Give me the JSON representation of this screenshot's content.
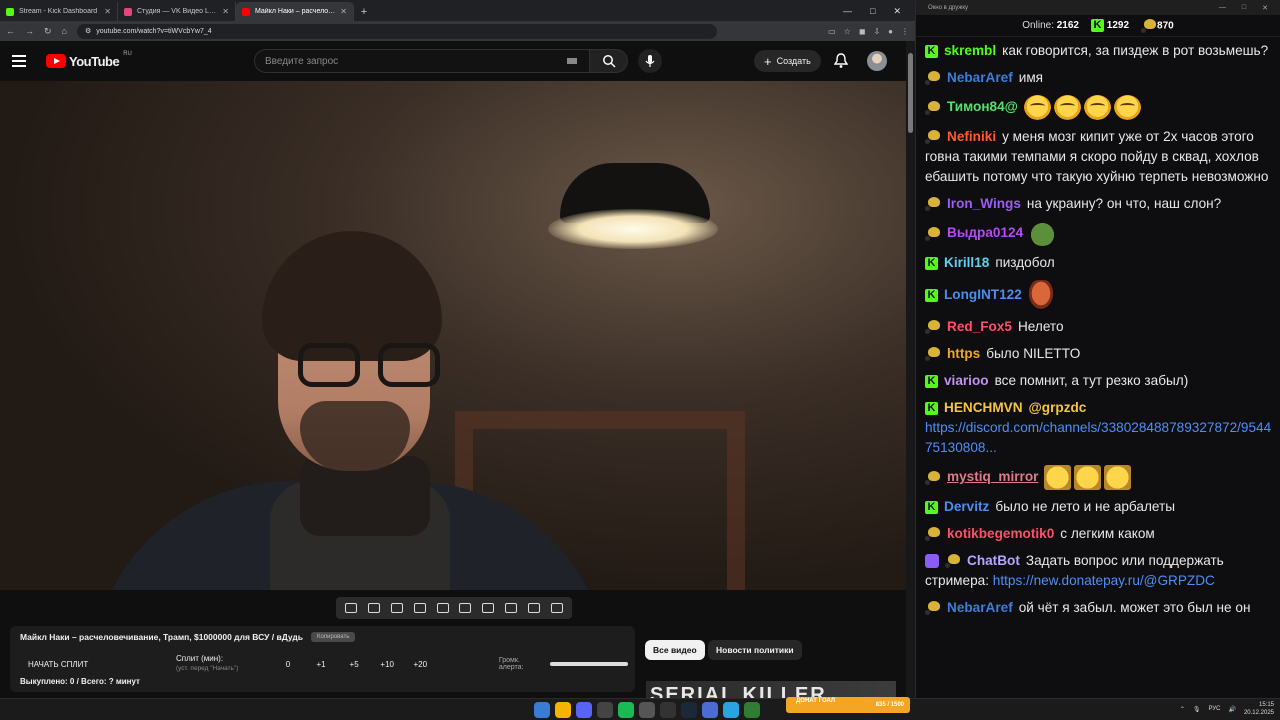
{
  "browser": {
    "tabs": [
      {
        "title": "Stream - Kick Dashboard",
        "color": "#53fc18",
        "active": false
      },
      {
        "title": "Студия — VK Видео Live",
        "color": "#e6457a",
        "active": false
      },
      {
        "title": "Майкл Наки – расчеловечива",
        "color": "#ff0000",
        "active": true
      }
    ],
    "url": "youtube.com/watch?v=tiWVcbYw7_4"
  },
  "youtube": {
    "logo": "YouTube",
    "region": "RU",
    "search_placeholder": "Введите запрос",
    "create_label": "Создать",
    "chips": {
      "all_videos": "Все видео",
      "politics": "Новости политики"
    },
    "thumb_title": "SERIAL KILLER"
  },
  "overlay_panel": {
    "title": "Майкл Наки – расчеловечивание, Трамп, $1000000 для ВСУ / вДудь",
    "copy_label": "Копировать",
    "start_split": "НАЧАТЬ СПЛИТ",
    "split_label": "Сплит (мин):",
    "split_hint": "(уст. перед \"Начать\")",
    "split_value": "0",
    "increments": [
      "+1",
      "+5",
      "+10",
      "+20"
    ],
    "volume_label": "Громк. алерта:",
    "footer": "Выкуплено: 0 / Всего: ? минут"
  },
  "chat": {
    "window_title": "Окно в дружку",
    "online_label": "Online:",
    "online_count": "2162",
    "kick_count": "1292",
    "dd_count": "870",
    "colors": {
      "kick": "#53fc18",
      "link": "#4f8ef7"
    },
    "messages": [
      {
        "badge": "kick",
        "user": "skrembl",
        "color": "#53fc18",
        "text": "как говорится, за пиздеж в рот возьмешь?"
      },
      {
        "badge": "dd",
        "user": "NebarAref",
        "color": "#3c7ed8",
        "text": "имя"
      },
      {
        "badge": "dd",
        "user": "Тимон84@",
        "color": "#55e06a",
        "text": "",
        "emotes": [
          "cry",
          "cry",
          "cry",
          "cry"
        ]
      },
      {
        "badge": "dd",
        "user": "Nefiniki",
        "color": "#ff5a2c",
        "text": "у меня мозг кипит уже от 2х часов этого говна такими темпами я скоро пойду в сквад, хохлов ебашить потому что такую хуйню терпеть невозможно"
      },
      {
        "badge": "dd",
        "user": "Iron_Wings",
        "color": "#9b5cf6",
        "text": "на украину? он что, наш слон?"
      },
      {
        "badge": "dd",
        "user": "Выдра0124",
        "color": "#b44cf0",
        "text": "",
        "emotes": [
          "frog"
        ]
      },
      {
        "badge": "kick",
        "user": "Kirill18",
        "color": "#5ad2f0",
        "text": "пиздобол"
      },
      {
        "badge": "kick",
        "user": "LongINT122",
        "color": "#4a8ef0",
        "text": "",
        "emotes": [
          "face"
        ]
      },
      {
        "badge": "dd",
        "user": "Red_Fox5",
        "color": "#ff4f6a",
        "text": "Нелето"
      },
      {
        "badge": "dd",
        "user": "https",
        "color": "#f5a623",
        "text": "было NILETTO"
      },
      {
        "badge": "kick",
        "user": "viarioo",
        "color": "#c490f0",
        "text": "все помнит, а тут резко забыл)"
      },
      {
        "badge": "kick",
        "user": "HENCHMVN",
        "color": "#f5c542",
        "text": "@grpzdc",
        "text_color": "#f5c542",
        "link": "https://discord.com/channels/338028488789327872/954475130808..."
      },
      {
        "badge": "dd",
        "user": "mystiq_mirror",
        "color": "#e07a8a",
        "text": "",
        "emotes": [
          "sq",
          "sq",
          "sq"
        ],
        "underline": true
      },
      {
        "badge": "kick",
        "user": "Dervitz",
        "color": "#4a8ef0",
        "text": "было не лето и не арбалеты"
      },
      {
        "badge": "dd",
        "user": "kotikbegemotik0",
        "color": "#ff4f6a",
        "text": "с легким каком"
      },
      {
        "badge": "bot",
        "user": "ChatBot",
        "color": "#b5a6ff",
        "text": "Задать вопрос или поддержать стримера:",
        "link": "https://new.donatepay.ru/@GRPZDC"
      },
      {
        "badge": "dd",
        "user": "NebarAref",
        "color": "#3c7ed8",
        "text": "ой чёт я забыл. может это был не он"
      }
    ]
  },
  "taskbar": {
    "widget_label": "ДОНАТ ГОАЛ",
    "widget_value": "835 / 1500",
    "lang": "РУС",
    "time": "15:15",
    "date": "20.12.2025"
  }
}
